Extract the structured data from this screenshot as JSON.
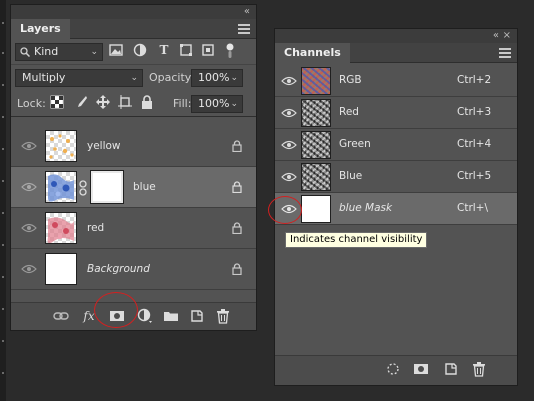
{
  "layers_panel": {
    "tab": "Layers",
    "collapse_glyph": "«",
    "filter_kind": "Kind",
    "filter_icons": [
      "image-filter-icon",
      "adjustment-filter-icon",
      "type-filter-icon",
      "shape-filter-icon",
      "smart-object-filter-icon",
      "filter-toggle-icon"
    ],
    "blend_mode": "Multiply",
    "opacity_label": "Opacity:",
    "opacity_value": "100%",
    "lock_label": "Lock:",
    "fill_label": "Fill:",
    "fill_value": "100%",
    "layers": [
      {
        "name": "yellow",
        "thumb": "yellow",
        "locked": true
      },
      {
        "name": "blue",
        "thumb": "blue",
        "has_mask": true,
        "active": true,
        "locked": true
      },
      {
        "name": "red",
        "thumb": "red",
        "locked": true
      },
      {
        "name": "Background",
        "thumb": "white",
        "italic": true,
        "locked": true
      }
    ],
    "footer_icons": [
      "link-layers-icon",
      "fx-icon",
      "add-mask-icon",
      "adjustment-layer-icon",
      "group-folder-icon",
      "new-layer-icon",
      "delete-layer-icon"
    ],
    "fx_label": "fx"
  },
  "channels_panel": {
    "tab": "Channels",
    "collapse_glyph": "«",
    "close_glyph": "×",
    "channels": [
      {
        "name": "RGB",
        "shortcut": "Ctrl+2"
      },
      {
        "name": "Red",
        "shortcut": "Ctrl+3"
      },
      {
        "name": "Green",
        "shortcut": "Ctrl+4"
      },
      {
        "name": "Blue",
        "shortcut": "Ctrl+5"
      },
      {
        "name": "blue Mask",
        "shortcut": "Ctrl+\\",
        "active": true,
        "italic": true
      }
    ],
    "footer_icons": [
      "load-selection-icon",
      "save-selection-icon",
      "new-channel-icon",
      "delete-channel-icon"
    ]
  },
  "tooltip": "Indicates channel visibility",
  "colors": {
    "panel_bg": "#535353",
    "selected_row": "#6a6a6a",
    "annotation_red": "#d32020",
    "tooltip_bg": "#ffffe1"
  }
}
